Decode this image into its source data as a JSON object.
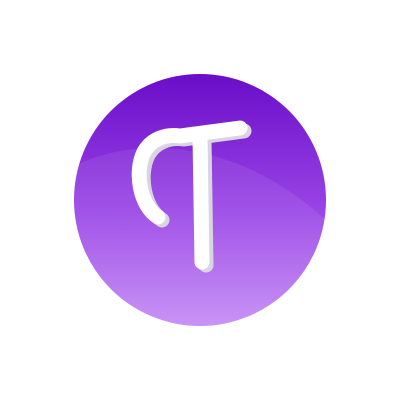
{
  "logo": {
    "letter": "T",
    "icon": "letter-t-logo-icon",
    "colors": {
      "gradient_top": "#6a0dc9",
      "gradient_bottom": "#c48bf5",
      "letter": "#ffffff",
      "letter_shadow": "#d8d4e0",
      "background": "#ffffff"
    }
  }
}
